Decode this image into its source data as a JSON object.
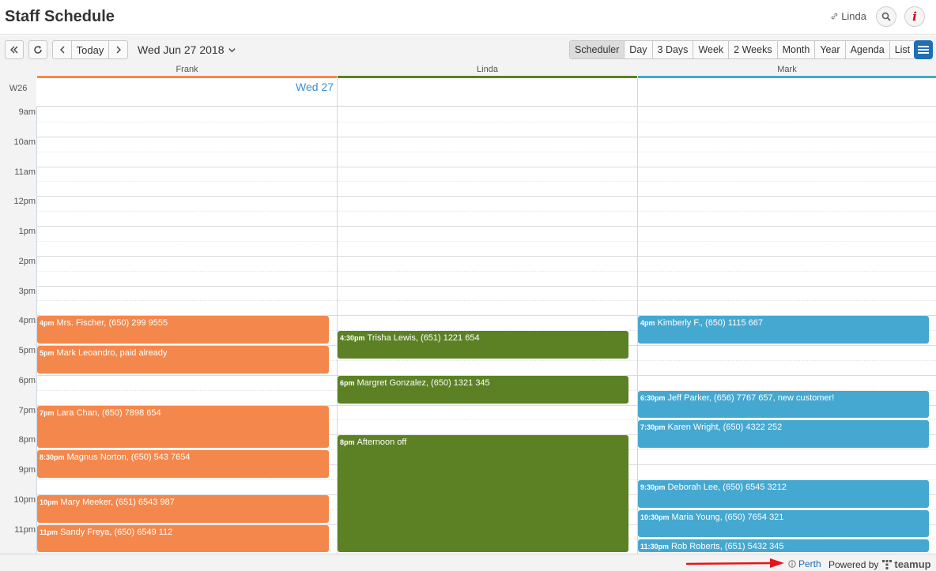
{
  "header": {
    "title": "Staff Schedule",
    "user": "Linda",
    "search_icon": "search-icon",
    "info_icon": "info-icon",
    "info_glyph": "i"
  },
  "toolbar": {
    "today_label": "Today",
    "date_title": "Wed Jun 27 2018",
    "views": [
      "Scheduler",
      "Day",
      "3 Days",
      "Week",
      "2 Weeks",
      "Month",
      "Year",
      "Agenda",
      "List"
    ],
    "active_view": "Scheduler"
  },
  "columns": [
    {
      "name": "Frank",
      "color": "#f4874b"
    },
    {
      "name": "Linda",
      "color": "#5b8124"
    },
    {
      "name": "Mark",
      "color": "#45a8d1"
    }
  ],
  "allday": {
    "week_label": "W26",
    "day_label": "Wed 27"
  },
  "time_labels": [
    "9am",
    "10am",
    "11am",
    "12pm",
    "1pm",
    "2pm",
    "3pm",
    "4pm",
    "5pm",
    "6pm",
    "7pm",
    "8pm",
    "9pm",
    "10pm",
    "11pm"
  ],
  "events": [
    {
      "col": 0,
      "start": 16.0,
      "end": 17.0,
      "time": "4pm",
      "title": "Mrs. Fischer, (650) 299 9555"
    },
    {
      "col": 0,
      "start": 17.0,
      "end": 18.0,
      "time": "5pm",
      "title": "Mark Leoandro, paid already"
    },
    {
      "col": 0,
      "start": 19.0,
      "end": 20.5,
      "time": "7pm",
      "title": "Lara Chan, (650) 7898 654"
    },
    {
      "col": 0,
      "start": 20.5,
      "end": 21.5,
      "time": "8:30pm",
      "title": "Magnus Norton, (650) 543 7654"
    },
    {
      "col": 0,
      "start": 22.0,
      "end": 23.0,
      "time": "10pm",
      "title": "Mary Meeker, (651) 6543 987"
    },
    {
      "col": 0,
      "start": 23.0,
      "end": 24.0,
      "time": "11pm",
      "title": "Sandy Freya, (650) 6549 112"
    },
    {
      "col": 1,
      "start": 16.5,
      "end": 17.5,
      "time": "4:30pm",
      "title": "Trisha Lewis, (651) 1221 654"
    },
    {
      "col": 1,
      "start": 18.0,
      "end": 19.0,
      "time": "6pm",
      "title": "Margret Gonzalez, (650) 1321 345"
    },
    {
      "col": 1,
      "start": 20.0,
      "end": 24.0,
      "time": "8pm",
      "title": "Afternoon off"
    },
    {
      "col": 2,
      "start": 16.0,
      "end": 17.0,
      "time": "4pm",
      "title": "Kimberly F., (650) 1115 667"
    },
    {
      "col": 2,
      "start": 18.5,
      "end": 19.5,
      "time": "6:30pm",
      "title": "Jeff Parker, (656) 7767 657, new customer!"
    },
    {
      "col": 2,
      "start": 19.5,
      "end": 20.5,
      "time": "7:30pm",
      "title": "Karen Wright, (650) 4322 252"
    },
    {
      "col": 2,
      "start": 21.5,
      "end": 22.5,
      "time": "9:30pm",
      "title": "Deborah Lee, (650) 6545 3212"
    },
    {
      "col": 2,
      "start": 22.5,
      "end": 23.5,
      "time": "10:30pm",
      "title": "Maria Young, (650) 7654 321"
    },
    {
      "col": 2,
      "start": 23.5,
      "end": 24.0,
      "time": "11:30pm",
      "title": "Rob Roberts, (651) 5432 345"
    }
  ],
  "footer": {
    "timezone": "Perth",
    "powered_by": "Powered by",
    "brand": "teamup"
  }
}
